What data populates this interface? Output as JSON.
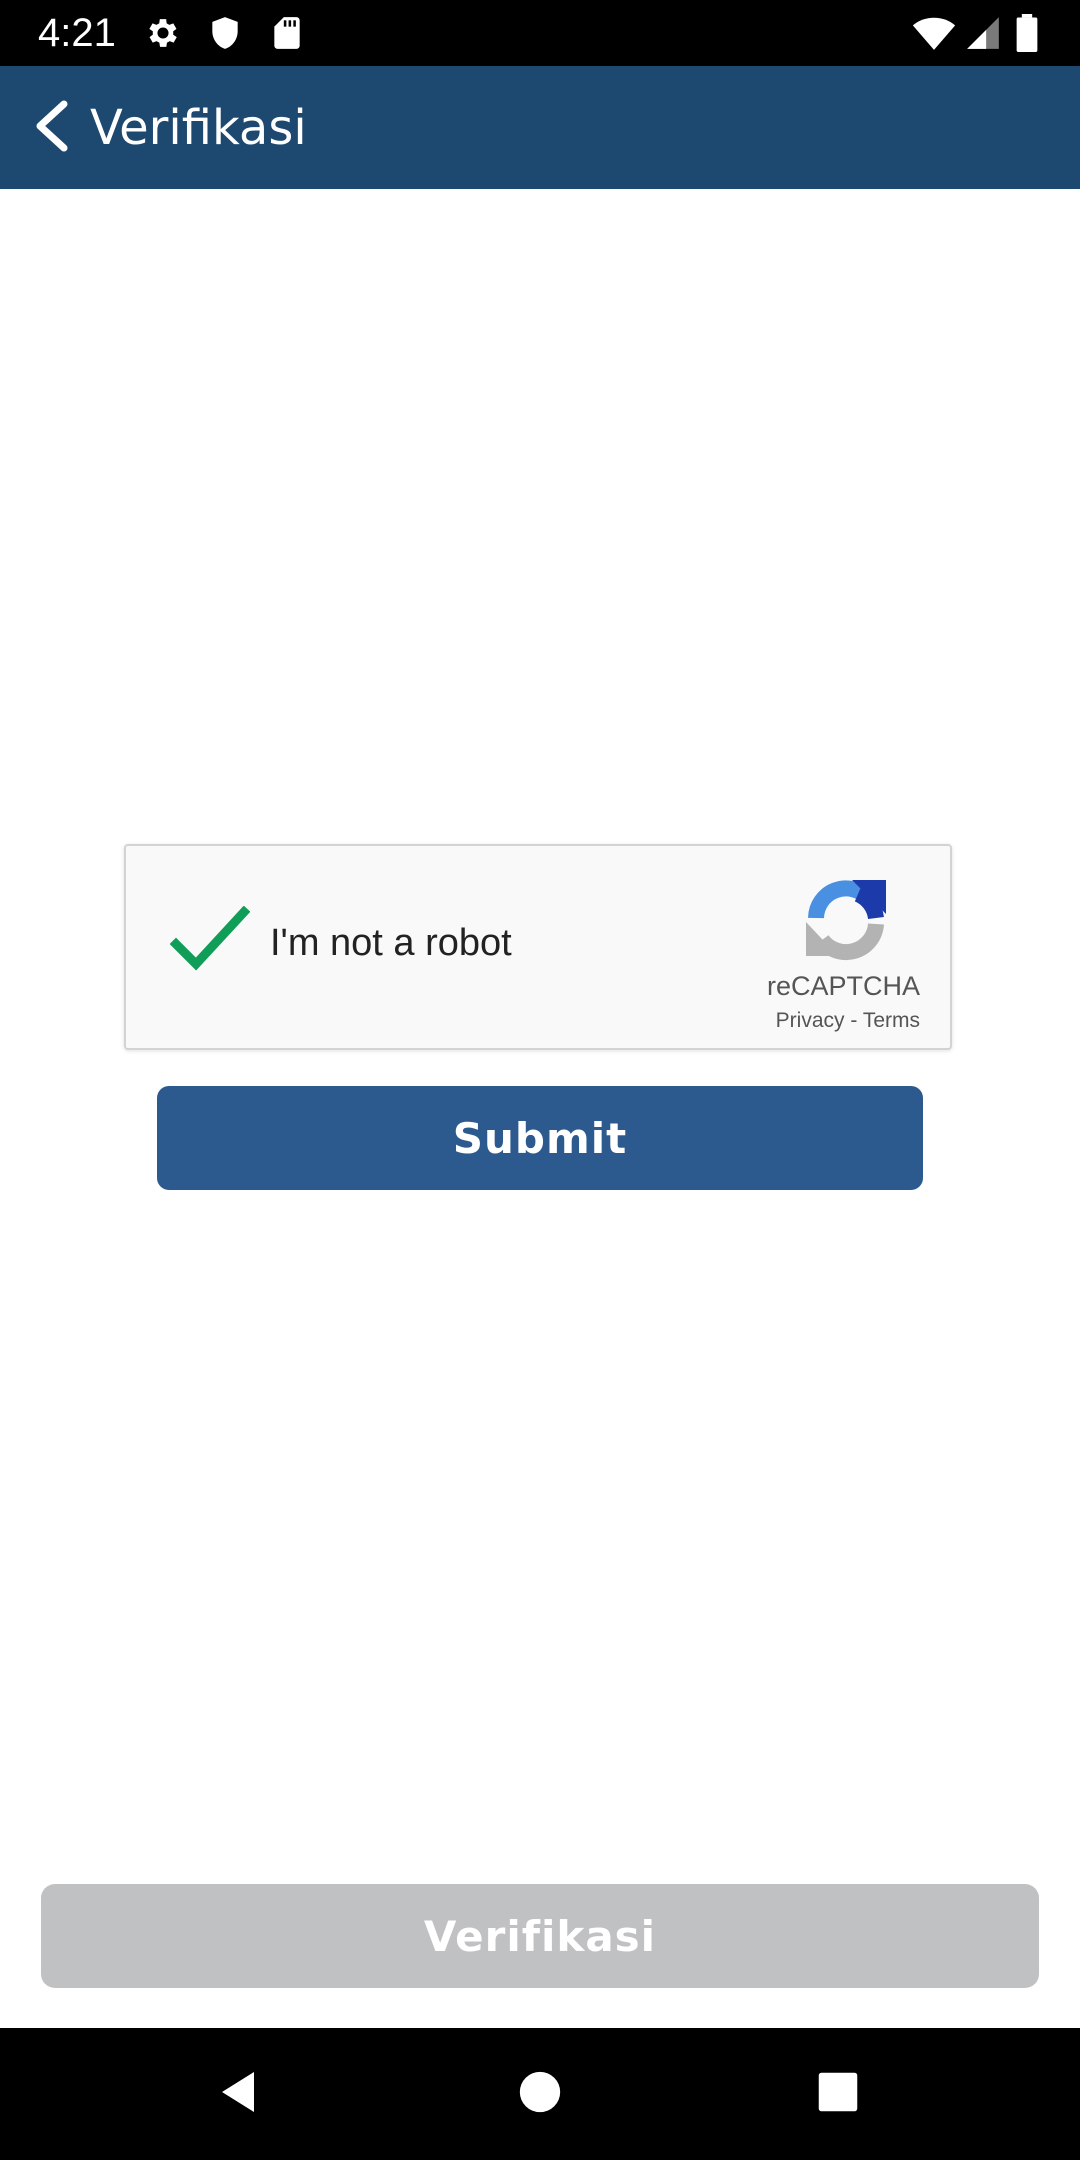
{
  "status_bar": {
    "time": "4:21",
    "icons": [
      "gear-icon",
      "shield-icon",
      "sd-card-icon",
      "wifi-icon",
      "signal-icon",
      "battery-icon"
    ]
  },
  "app_bar": {
    "title": "Verifikasi",
    "back_icon": "chevron-left-icon",
    "background": "#1d4870"
  },
  "recaptcha": {
    "label": "I'm not a robot",
    "checked": true,
    "brand": "reCAPTCHA",
    "privacy_link": "Privacy",
    "separator": " - ",
    "terms_link": "Terms",
    "check_color": "#0f9d58"
  },
  "submit": {
    "label": "Submit",
    "color": "#2c5a8e"
  },
  "verify": {
    "label": "Verifikasi",
    "enabled": false,
    "color": "#bfc1c3"
  },
  "nav_bar": {
    "icons": [
      "back-triangle-icon",
      "home-circle-icon",
      "recents-square-icon"
    ]
  }
}
